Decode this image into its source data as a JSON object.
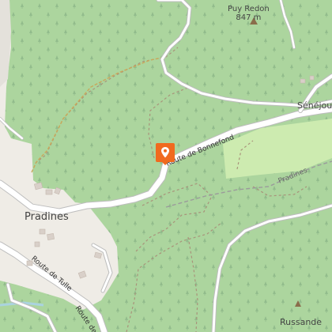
{
  "map": {
    "places": {
      "pradines": "Pradines",
      "senejoux": "Sénéjoux",
      "russande": "Russande"
    },
    "peak": {
      "name": "Puy Redon",
      "elevation": "847 m"
    },
    "roads": {
      "route_bonnefond": "Route de Bonnefond",
      "route_tulle_a": "Route de Tulle",
      "route_tulle_b": "Route de T"
    },
    "trails": {
      "pradines_trail": "Pradines"
    },
    "marker": {
      "icon": "location-pin-icon",
      "color": "#f06a1f"
    },
    "colors": {
      "forest": "#acd59e",
      "meadow": "#cdebb0",
      "village": "#f2efe9",
      "road": "#ffffff",
      "water": "#aad3df"
    }
  }
}
